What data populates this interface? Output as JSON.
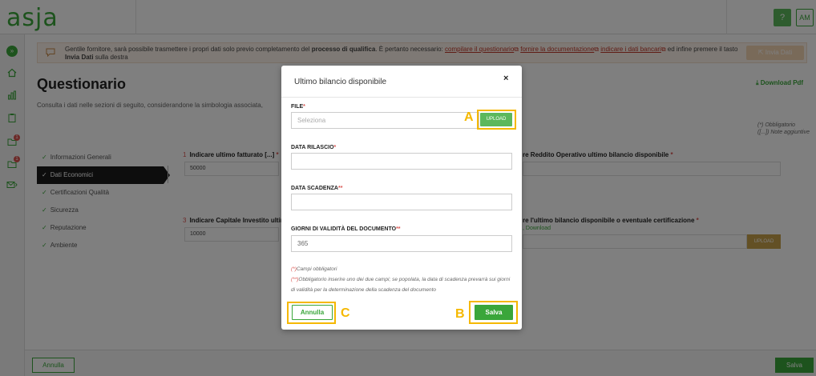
{
  "header": {
    "logo": "asja",
    "help": "?",
    "avatar": "AM"
  },
  "sidebar": {
    "items": [
      {
        "icon": "expand-icon"
      },
      {
        "icon": "home-icon"
      },
      {
        "icon": "chart-icon"
      },
      {
        "icon": "clipboard-icon"
      },
      {
        "icon": "folder-icon",
        "badge": "1"
      },
      {
        "icon": "folder-icon",
        "badge": "1"
      },
      {
        "icon": "mail-icon"
      }
    ]
  },
  "notice": {
    "text_1": "Gentile fornitore, sarà possibile trasmettere i propri dati solo previo completamento del ",
    "bold_1": "processo di qualifica",
    "text_2": ". È pertanto necessario: ",
    "link_1": "compilare il questionario",
    "link_2": "fornire la documentazione",
    "link_3": "indicare i dati bancari",
    "text_3": " ed infine premere il tasto ",
    "bold_2": "Invia Dati",
    "text_4": " sulla destra",
    "button": "Invia Dati"
  },
  "page": {
    "title": "Questionario",
    "subtitle": "Consulta i dati nelle sezioni di seguito, considerandone la simbologia associata, ",
    "download_pdf": "Download Pdf",
    "legend_1": "(*) Obbligatorio",
    "legend_2": "([...]) Note aggiuntive"
  },
  "sections": [
    {
      "label": "Informazioni Generali",
      "active": false
    },
    {
      "label": "Dati Economici",
      "active": true
    },
    {
      "label": "Certificazioni Qualità",
      "active": false
    },
    {
      "label": "Sicurezza",
      "active": false
    },
    {
      "label": "Reputazione",
      "active": false
    },
    {
      "label": "Ambiente",
      "active": false
    }
  ],
  "background_form": {
    "q1_num": "1",
    "q1_label": "Indicare ultimo fatturato [...]",
    "q1_value": "50000",
    "q2_label": "re Reddito Operativo ultimo bilancio disponibile",
    "q3_num": "3",
    "q3_label": "Indicare Capitale Investito ultimo",
    "q3_value": "10000",
    "q4_label": "re l'ultimo bilancio disponibile o eventuale certificazione",
    "q4_download": "Download",
    "q4_upload": "UPLOAD"
  },
  "footer": {
    "annulla": "Annulla",
    "salva": "Salva"
  },
  "modal": {
    "title": "Ultimo bilancio disponibile",
    "file_label": "FILE",
    "file_placeholder": "Seleziona",
    "upload": "UPLOAD",
    "data_rilascio_label": "DATA RILASCIO",
    "data_scadenza_label": "DATA SCADENZA",
    "giorni_label": "GIORNI DI VALIDITÀ DEL DOCUMENTO",
    "giorni_value": "365",
    "note_1_mark": "(*)",
    "note_1": "Campi obbligatori",
    "note_2_mark": "(**)",
    "note_2": "Obbligatorio inserire uno dei due campi; se popolata, la data di scadenza prevarrà sui giorni di validità per la determinazione della scadenza del documento",
    "annulla": "Annulla",
    "salva": "Salva"
  },
  "callouts": {
    "a": "A",
    "b": "B",
    "c": "C"
  },
  "colors": {
    "brand_green": "#3aa63a",
    "callout_yellow": "#f5b800",
    "required_red": "#d9534f"
  }
}
